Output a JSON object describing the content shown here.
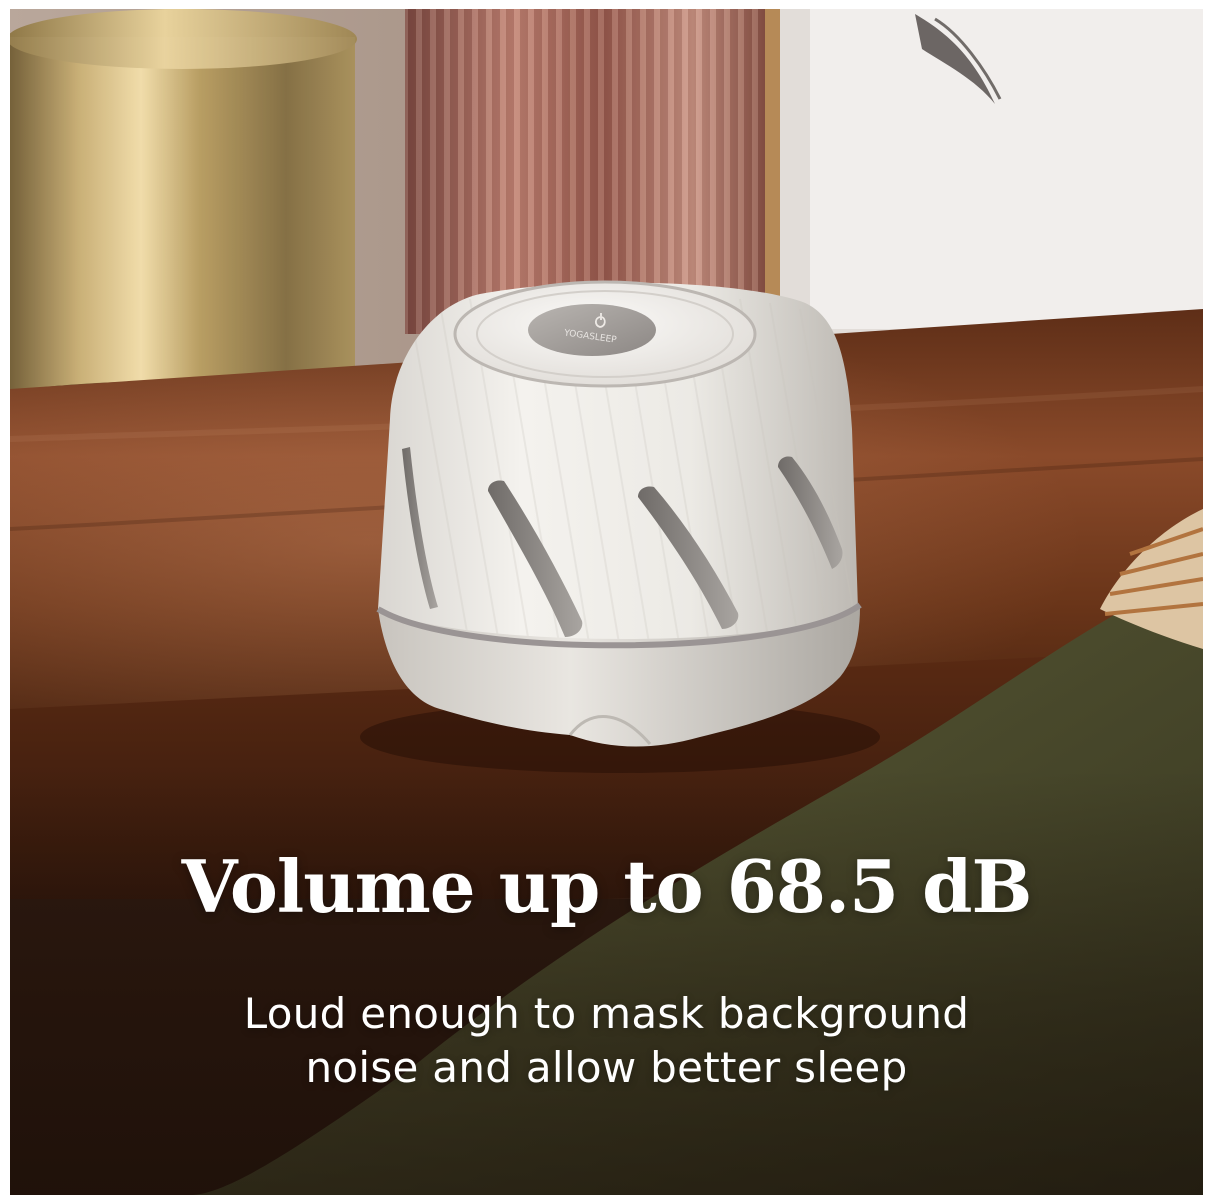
{
  "ad": {
    "headline": "Volume up to 68.5 dB",
    "subline_1": "Loud enough to mask background",
    "subline_2": "noise and allow better sleep"
  },
  "product": {
    "brand_mark": "YOGASLEEP",
    "body_color": "#eeece8",
    "accent_color": "#9a9494"
  },
  "icons": {
    "power": "power-icon"
  }
}
